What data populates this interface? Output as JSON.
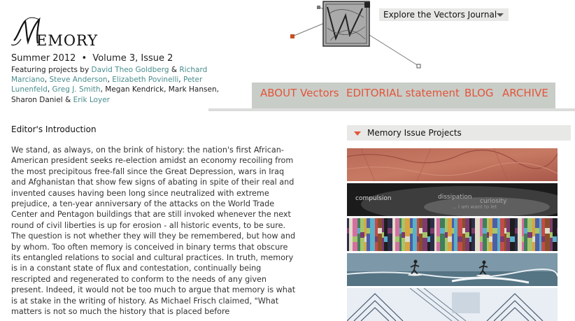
{
  "site": {
    "logo_text": "EMORY",
    "issue_season": "Summer 2012",
    "issue_bullet": "•",
    "issue_volume": "Volume 3, Issue 2"
  },
  "featuring": {
    "prefix": "Featuring projects by ",
    "people": [
      "David Theo Goldberg",
      "Richard Marciano",
      "Steve Anderson",
      "Elizabeth Povinelli",
      "Peter Lunenfeld",
      "Greg J. Smith",
      "Megan Kendrick",
      "Mark Hansen",
      "Sharon Daniel",
      "Erik Loyer"
    ]
  },
  "explore": {
    "label": "Explore the Vectors Journal",
    "icon": "chevron-down-icon"
  },
  "nav": {
    "about": "ABOUT Vectors",
    "editorial": "EDITORIAL statement",
    "blog": "BLOG",
    "archive": "ARCHIVE"
  },
  "main": {
    "heading": "Editor's Introduction",
    "body": "We stand, as always, on the brink of history: the nation's first African-American president seeks re-election amidst an economy recoiling from the most precipitous free-fall since the Great Depression, wars in Iraq and Afghanistan that show few signs of abating in spite of their real and invented causes having been long since neutralized with extreme prejudice, a ten-year anniversary of the attacks on the World Trade Center and Pentagon buildings that are still invoked whenever the next round of civil liberties is up for erosion - all historic events, to be sure. The question is not whether they will they be remembered, but how and by whom. Too often memory is conceived in binary terms that obscure its entangled relations to social and cultural practices. In truth, memory is in a constant state of flux and contestation, continually being rescripted and regenerated to conform to the needs of any given present. Indeed, it would not be too much to argue that memory is what is at stake in the writing of history. As Michael Frisch claimed, \"What matters is not so much the history that is placed before"
  },
  "projects_panel": {
    "title": "Memory Issue Projects",
    "thumb2_words": [
      "compulsion",
      "dissipation",
      "curiosity",
      "... I am want to let"
    ]
  },
  "colors": {
    "accent": "#e2553a",
    "link": "#4a8c8c",
    "nav_bg": "#c9cdc8",
    "panel_bg": "#e8e8e6"
  }
}
